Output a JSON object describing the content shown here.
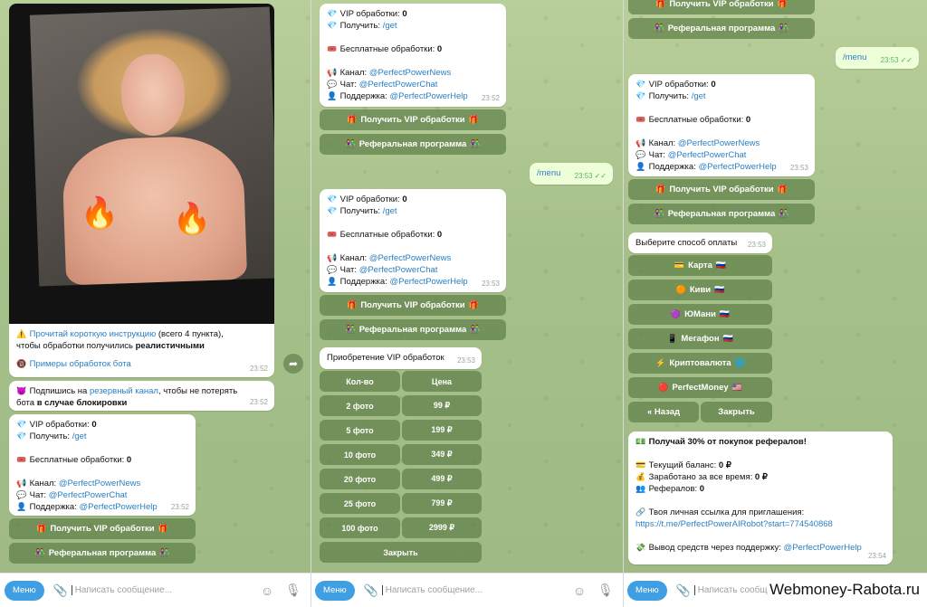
{
  "status_lines": {
    "vip_label": "VIP обработки:",
    "vip_value": "0",
    "get_label": "Получить:",
    "get_cmd": "/get",
    "free_label": "Бесплатные обработки:",
    "free_value": "0",
    "channel_label": "Канал:",
    "channel_link": "@PerfectPowerNews",
    "chat_label": "Чат:",
    "chat_link": "@PerfectPowerChat",
    "support_label": "Поддержка:",
    "support_link": "@PerfectPowerHelp"
  },
  "buttons": {
    "get_vip": "Получить VIP обработки",
    "referral": "Реферальная программа"
  },
  "pane1": {
    "photo_caption": {
      "link1": "Прочитай короткую инструкцию",
      "text1": " (всего 4 пункта),",
      "text2": "чтобы обработки получились ",
      "bold2": "реалистичными",
      "link2": "Примеры обработок бота",
      "time": "23:52"
    },
    "reserve": {
      "text1": "Подпишись на ",
      "link": "резервный канал",
      "text2": ", чтобы не потерять",
      "text3": "бота ",
      "bold": "в случае блокировки",
      "time": "23:52"
    },
    "status_time": "23:52"
  },
  "pane2": {
    "status1_time": "23:52",
    "sent_menu": "/menu",
    "sent_time": "23:53",
    "status2_time": "23:53",
    "purchase_title": "Приобретение VIP обработок",
    "purchase_time": "23:53",
    "table_headers": [
      "Кол-во",
      "Цена"
    ],
    "table_rows": [
      [
        "2 фото",
        "99 ₽"
      ],
      [
        "5 фото",
        "199 ₽"
      ],
      [
        "10 фото",
        "349 ₽"
      ],
      [
        "20 фото",
        "499 ₽"
      ],
      [
        "25 фото",
        "799 ₽"
      ],
      [
        "100 фото",
        "2999 ₽"
      ]
    ],
    "close": "Закрыть"
  },
  "pane3": {
    "sent_menu": "/menu",
    "sent_time": "23:53",
    "status_time": "23:53",
    "pay_title": "Выберите способ оплаты",
    "pay_time": "23:53",
    "pay_methods": [
      "Карта",
      "Киви",
      "ЮМани",
      "Мегафон",
      "Криптовалюта",
      "PerfectMoney"
    ],
    "back": "« Назад",
    "close": "Закрыть",
    "referral": {
      "title": "Получай 30% от покупок рефералов!",
      "balance": "Текущий баланс: ",
      "balance_val": "0 ₽",
      "earned": "Заработано за все время: ",
      "earned_val": "0 ₽",
      "refs": "Рефералов: ",
      "refs_val": "0",
      "link_label": "Твоя личная ссылка для приглашения:",
      "link": "https://t.me/PerfectPowerAIRobot?start=774540868",
      "withdraw": "Вывод средств через поддержку: ",
      "withdraw_link": "@PerfectPowerHelp",
      "time": "23:54"
    }
  },
  "input": {
    "menu": "Меню",
    "placeholder": "Написать сообщение..."
  },
  "watermark": "Webmoney-Rabota.ru",
  "colors": {
    "link": "#2a7fc5",
    "keyboard": "#60804a",
    "menu_button": "#3f9fe2"
  }
}
